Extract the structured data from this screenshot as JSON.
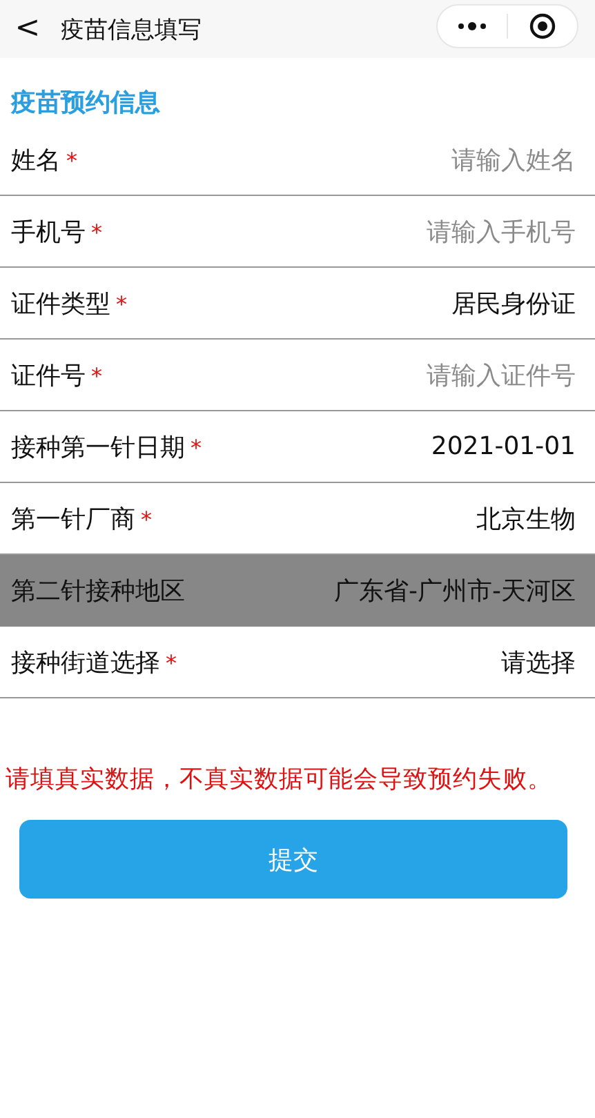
{
  "nav_bar": {
    "back": "<",
    "title": "疫苗信息填写"
  },
  "section_title": "疫苗预约信息",
  "rows": [
    {
      "kind": "input",
      "label": "姓名",
      "asterisk": "*",
      "placeholder": "请输入姓名",
      "pressed": false
    },
    {
      "kind": "input",
      "label": "手机号",
      "asterisk": "*",
      "placeholder": "请输入手机号",
      "pressed": false
    },
    {
      "kind": "picker",
      "label": "证件类型",
      "asterisk": "*",
      "value": "居民身份证",
      "pressed": false
    },
    {
      "kind": "input",
      "label": "证件号",
      "asterisk": "*",
      "placeholder": "请输入证件号",
      "pressed": false
    },
    {
      "kind": "picker",
      "label": "接种第一针日期",
      "asterisk": "*",
      "value": "2021-01-01",
      "pressed": false
    },
    {
      "kind": "picker",
      "label": "第一针厂商",
      "asterisk": "*",
      "value": "北京生物",
      "pressed": false
    },
    {
      "kind": "picker",
      "label": "第二针接种地区",
      "value": "广东省-广州市-天河区",
      "pressed": true
    },
    {
      "kind": "picker",
      "label": "接种街道选择",
      "asterisk": "*",
      "value": "请选择",
      "pressed": false
    }
  ],
  "notice": "请填真实数据，不真实数据可能会导致预约失败。",
  "submit_button": "提交"
}
